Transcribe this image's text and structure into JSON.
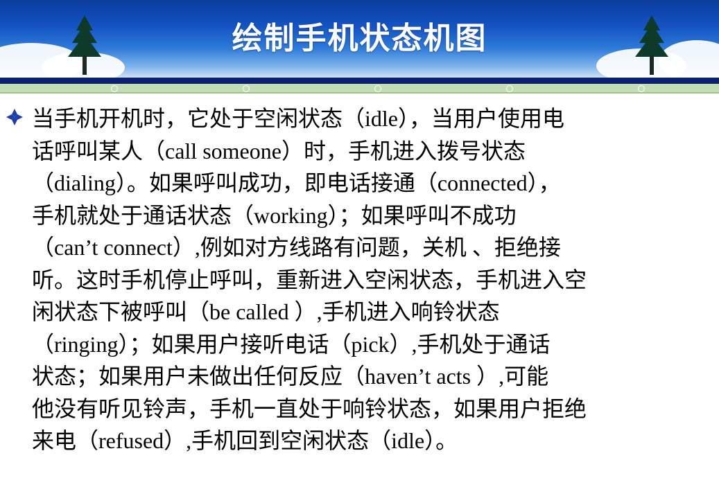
{
  "slide": {
    "title": "绘制手机状态机图",
    "lines": [
      "当手机开机时，它处于空闲状态（idle），当用户使用电",
      "话呼叫某人（call someone）时，手机进入拨号状态",
      "（dialing）。如果呼叫成功，即电话接通（connected），",
      "手机就处于通话状态（working）；如果呼叫不成功",
      "（can’t connect）,例如对方线路有问题，关机 、拒绝接",
      "听。这时手机停止呼叫，重新进入空闲状态，手机进入空",
      "闲状态下被呼叫（be called ）,手机进入响铃状态",
      "（ringing）；如果用户接听电话（pick）,手机处于通话",
      "状态；如果用户未做出任何反应（haven’t acts ）,可能",
      "他没有听见铃声，手机一直处于响铃状态，如果用户拒绝",
      "来电（refused）,手机回到空闲状态（idle）。"
    ]
  },
  "colors": {
    "header_top": "#0b3c9e",
    "header_bottom": "#cfe3f7",
    "stripe_dark": "#0a1f6e",
    "stripe_green": "#c4dcb4",
    "bullet": "#1a3fa8",
    "text": "#000000"
  },
  "icons": {
    "bullet": "diamond-bullet-icon",
    "left_tree": "pine-tree-icon",
    "right_tree": "pine-tree-icon"
  }
}
